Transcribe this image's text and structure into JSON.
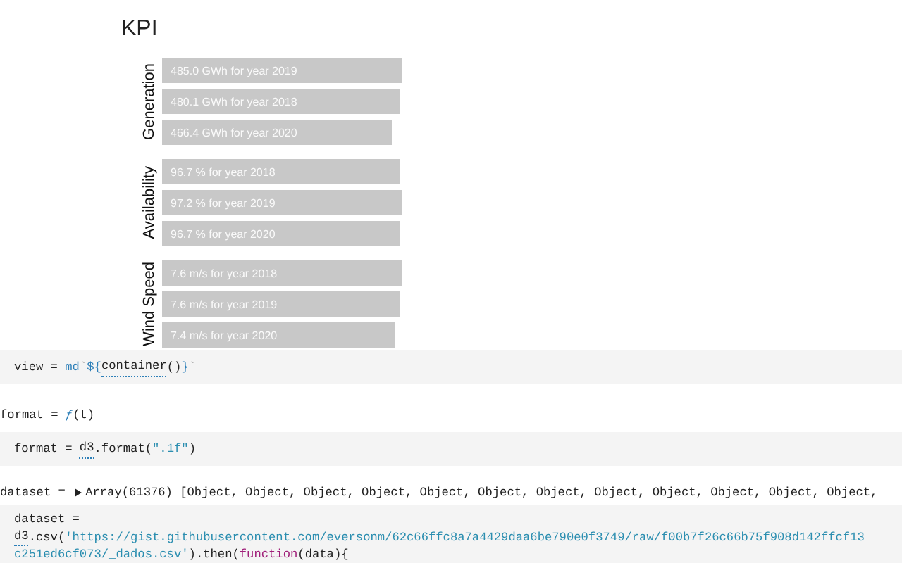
{
  "kpi": {
    "title": "KPI",
    "groups": [
      {
        "label": "Generation",
        "bars": [
          {
            "text": "485.0 GWh for year 2019",
            "level": 0.99
          },
          {
            "text": "480.1 GWh for year 2018",
            "level": 0.98
          },
          {
            "text": "466.4 GWh for year 2020",
            "level": 0.95
          }
        ]
      },
      {
        "label": "Availability",
        "bars": [
          {
            "text": "96.7 % for year 2018",
            "level": 0.985
          },
          {
            "text": "97.2 % for year 2019",
            "level": 0.99
          },
          {
            "text": "96.7 % for year 2020",
            "level": 0.985
          }
        ]
      },
      {
        "label": "Wind Speed",
        "bars": [
          {
            "text": "7.6 m/s for year 2018",
            "level": 0.99
          },
          {
            "text": "7.6 m/s for year 2019",
            "level": 0.98
          },
          {
            "text": "7.4 m/s for year 2020",
            "level": 0.96
          }
        ]
      }
    ]
  },
  "cells": [
    {
      "kind": "input",
      "lines": [
        [
          {
            "t": "view = ",
            "kind": "plain"
          },
          {
            "t": "md",
            "kind": "call"
          },
          {
            "t": "`",
            "kind": "punct"
          },
          {
            "t": "${",
            "kind": "call"
          },
          {
            "t": "container",
            "kind": "ref"
          },
          {
            "t": "()",
            "kind": "plain"
          },
          {
            "t": "}",
            "kind": "call"
          },
          {
            "t": "`",
            "kind": "punct"
          }
        ]
      ]
    },
    {
      "kind": "output",
      "lines": [
        [
          {
            "t": "format = ",
            "kind": "plain"
          },
          {
            "t": "ƒ",
            "kind": "fn"
          },
          {
            "t": "(t)",
            "kind": "plain"
          }
        ]
      ]
    },
    {
      "kind": "input",
      "lines": [
        [
          {
            "t": "format = ",
            "kind": "plain"
          },
          {
            "t": "d3",
            "kind": "ref"
          },
          {
            "t": ".format(",
            "kind": "plain"
          },
          {
            "t": "\".1f\"",
            "kind": "string"
          },
          {
            "t": ")",
            "kind": "plain"
          }
        ]
      ]
    },
    {
      "kind": "output",
      "lines": [
        [
          {
            "t": "dataset = ",
            "kind": "plain"
          },
          {
            "kind": "expander",
            "expanded": false
          },
          {
            "t": "Array(61376) [Object, Object, Object, Object, Object, Object, Object, Object, Object, Object, Object, Object,",
            "kind": "plain"
          }
        ]
      ]
    },
    {
      "kind": "input",
      "lines": [
        [
          {
            "t": "dataset =",
            "kind": "plain"
          }
        ],
        [
          {
            "t": "d3",
            "kind": "ref"
          },
          {
            "t": ".csv(",
            "kind": "plain"
          },
          {
            "t": "'https://gist.githubusercontent.com/eversonm/62c66ffc8a7a4429daa6be790e0f3749/raw/f00b7f26c66b75f908d142ffcf13",
            "kind": "string"
          }
        ],
        [
          {
            "t": "c251ed6cf073/_dados.csv'",
            "kind": "string"
          },
          {
            "t": ").then(",
            "kind": "plain"
          },
          {
            "t": "function",
            "kind": "keyword"
          },
          {
            "t": "(data){",
            "kind": "plain"
          }
        ]
      ]
    }
  ]
}
